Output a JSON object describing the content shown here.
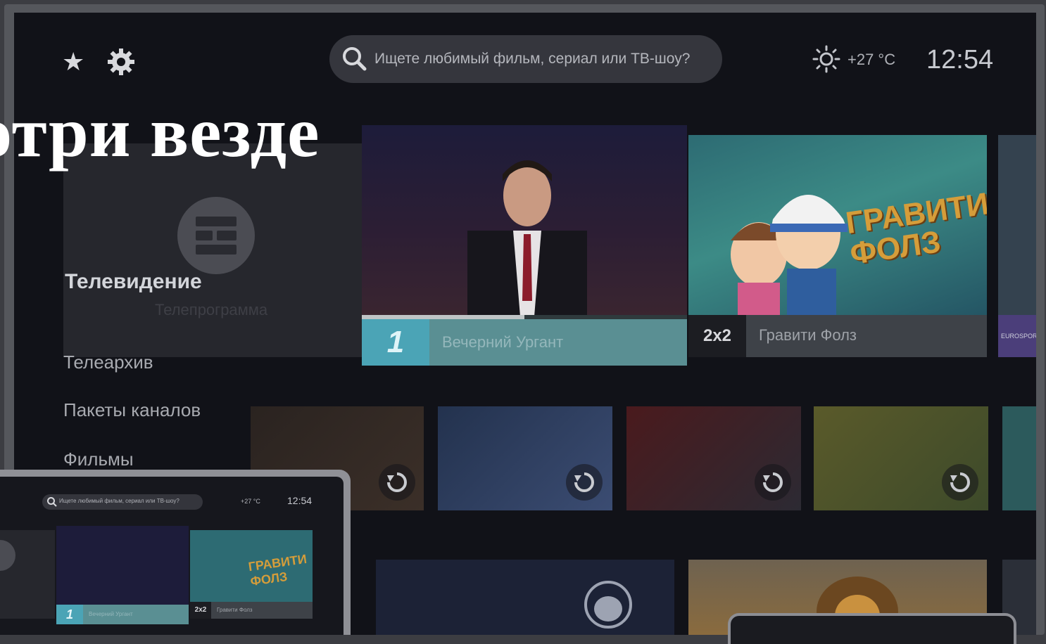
{
  "topbar": {
    "search_placeholder": "Ищете любимый фильм, сериал или ТВ-шоу?",
    "temperature": "+27 °C",
    "time": "12:54"
  },
  "headline": "отри везде",
  "menu": {
    "card_title": "Телевидение",
    "card_subtitle": "Телепрограмма",
    "items": [
      "Телеархив",
      "Пакеты каналов",
      "Фильмы"
    ]
  },
  "featured": [
    {
      "channel_logo": "1",
      "title": "Вечерний Ургант",
      "progress": 0.5
    },
    {
      "channel_logo": "2x2",
      "title": "Гравити Фолз",
      "art_text": "ГРАВИТИ ФОЛЗ"
    },
    {
      "channel_logo": "EUROSPORT"
    }
  ],
  "laptop": {
    "search_placeholder": "Ищете любимый фильм, сериал или ТВ-шоу?",
    "temperature": "+27 °C",
    "time": "12:54",
    "featured": [
      {
        "channel_logo": "1",
        "title": "Вечерний Ургант"
      },
      {
        "channel_logo": "2x2",
        "title": "Гравити Фолз",
        "art_text": "ГРАВИТИ ФОЛЗ"
      }
    ]
  },
  "icons": [
    "star-icon",
    "gear-icon",
    "search-icon",
    "sun-icon",
    "replay-icon",
    "tv-grid-icon"
  ],
  "colors": {
    "screen_bg": "#111218",
    "accent_teal": "#5a8f93",
    "logo_blue": "#4ba4b6",
    "art_orange": "#d59d3a"
  }
}
